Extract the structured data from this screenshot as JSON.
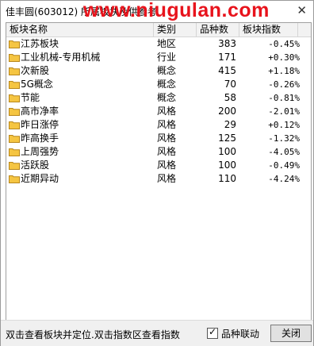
{
  "window": {
    "title": "佳丰圆(603012) 所属板块及供参考",
    "watermark": "www.niugulan.com"
  },
  "table": {
    "headers": [
      "板块名称",
      "类别",
      "品种数",
      "板块指数"
    ],
    "rows": [
      {
        "name": "江苏板块",
        "type": "地区",
        "count": "383",
        "change": "-0.45%"
      },
      {
        "name": "工业机械-专用机械",
        "type": "行业",
        "count": "171",
        "change": "+0.30%"
      },
      {
        "name": "次新股",
        "type": "概念",
        "count": "415",
        "change": "+1.18%"
      },
      {
        "name": "5G概念",
        "type": "概念",
        "count": "70",
        "change": "-0.26%"
      },
      {
        "name": "节能",
        "type": "概念",
        "count": "58",
        "change": "-0.81%"
      },
      {
        "name": "高市净率",
        "type": "风格",
        "count": "200",
        "change": "-2.01%"
      },
      {
        "name": "昨日涨停",
        "type": "风格",
        "count": "29",
        "change": "+0.12%"
      },
      {
        "name": "昨高换手",
        "type": "风格",
        "count": "125",
        "change": "-1.32%"
      },
      {
        "name": "上周强势",
        "type": "风格",
        "count": "100",
        "change": "-4.05%"
      },
      {
        "name": "活跃股",
        "type": "风格",
        "count": "100",
        "change": "-0.49%"
      },
      {
        "name": "近期异动",
        "type": "风格",
        "count": "110",
        "change": "-4.24%"
      }
    ]
  },
  "footer": {
    "hint": "双击查看板块并定位.双击指数区查看指数",
    "checkbox_label": "品种联动",
    "checkbox_checked": true,
    "close_label": "关闭"
  },
  "colors": {
    "watermark": "#e8131c",
    "folder": "#f5c542"
  }
}
